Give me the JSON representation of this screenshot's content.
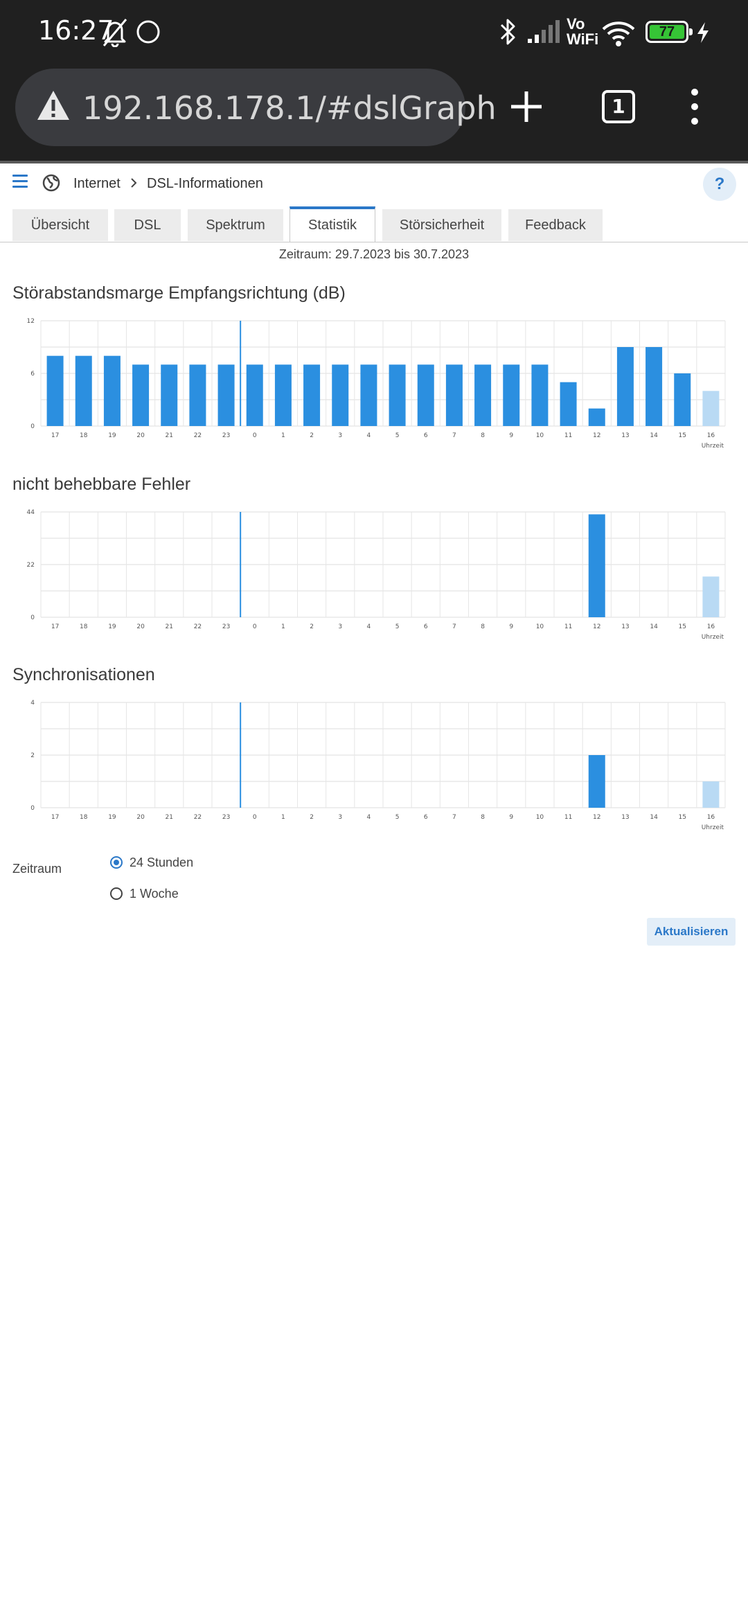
{
  "status_bar": {
    "time": "16:27",
    "vowifi_line1": "Vo",
    "vowifi_line2": "WiFi",
    "battery": "77",
    "icons": [
      "bell-off-icon",
      "circle-icon",
      "bluetooth-icon",
      "signal-icon",
      "wifi-icon",
      "battery-icon",
      "charging-icon"
    ]
  },
  "browser": {
    "url": "192.168.178.1/#dslGraph",
    "tab_count": "1"
  },
  "breadcrumb": {
    "item1": "Internet",
    "item2": "DSL-Informationen",
    "help": "?"
  },
  "tabs": [
    {
      "label": "Übersicht"
    },
    {
      "label": "DSL"
    },
    {
      "label": "Spektrum"
    },
    {
      "label": "Statistik"
    },
    {
      "label": "Störsicherheit"
    },
    {
      "label": "Feedback"
    }
  ],
  "active_tab": "Statistik",
  "period_text": "Zeitraum: 29.7.2023 bis 30.7.2023",
  "accent_color": "#2b8fe0",
  "current_bar_color": "#b9daf4",
  "chart_data": [
    {
      "type": "bar",
      "title": "Störabstandsmarge Empfangsrichtung (dB)",
      "xlabel": "Uhrzeit",
      "categories": [
        "17",
        "18",
        "19",
        "20",
        "21",
        "22",
        "23",
        "0",
        "1",
        "2",
        "3",
        "4",
        "5",
        "6",
        "7",
        "8",
        "9",
        "10",
        "11",
        "12",
        "13",
        "14",
        "15",
        "16"
      ],
      "values": [
        8,
        8,
        8,
        7,
        7,
        7,
        7,
        7,
        7,
        7,
        7,
        7,
        7,
        7,
        7,
        7,
        7,
        7,
        5,
        2,
        9,
        9,
        6,
        4
      ],
      "yticks": [
        "0",
        "6",
        "12"
      ],
      "ylim": [
        0,
        12
      ],
      "grid": true,
      "marker_after_category": "0",
      "last_bar_partial": true
    },
    {
      "type": "bar",
      "title": "nicht behebbare Fehler",
      "xlabel": "Uhrzeit",
      "categories": [
        "17",
        "18",
        "19",
        "20",
        "21",
        "22",
        "23",
        "0",
        "1",
        "2",
        "3",
        "4",
        "5",
        "6",
        "7",
        "8",
        "9",
        "10",
        "11",
        "12",
        "13",
        "14",
        "15",
        "16"
      ],
      "values": [
        0,
        0,
        0,
        0,
        0,
        0,
        0,
        0,
        0,
        0,
        0,
        0,
        0,
        0,
        0,
        0,
        0,
        0,
        0,
        43,
        0,
        0,
        0,
        17
      ],
      "yticks": [
        "0",
        "22",
        "44"
      ],
      "ylim": [
        0,
        44
      ],
      "grid": true,
      "marker_after_category": "0",
      "last_bar_partial": true
    },
    {
      "type": "bar",
      "title": "Synchronisationen",
      "xlabel": "Uhrzeit",
      "categories": [
        "17",
        "18",
        "19",
        "20",
        "21",
        "22",
        "23",
        "0",
        "1",
        "2",
        "3",
        "4",
        "5",
        "6",
        "7",
        "8",
        "9",
        "10",
        "11",
        "12",
        "13",
        "14",
        "15",
        "16"
      ],
      "values": [
        0,
        0,
        0,
        0,
        0,
        0,
        0,
        0,
        0,
        0,
        0,
        0,
        0,
        0,
        0,
        0,
        0,
        0,
        0,
        2,
        0,
        0,
        0,
        1
      ],
      "yticks": [
        "0",
        "2",
        "4"
      ],
      "ylim": [
        0,
        4
      ],
      "grid": true,
      "marker_after_category": "0",
      "last_bar_partial": true
    }
  ],
  "form": {
    "label": "Zeitraum",
    "option1": "24 Stunden",
    "option2": "1 Woche",
    "selected": "24 Stunden",
    "refresh": "Aktualisieren"
  }
}
